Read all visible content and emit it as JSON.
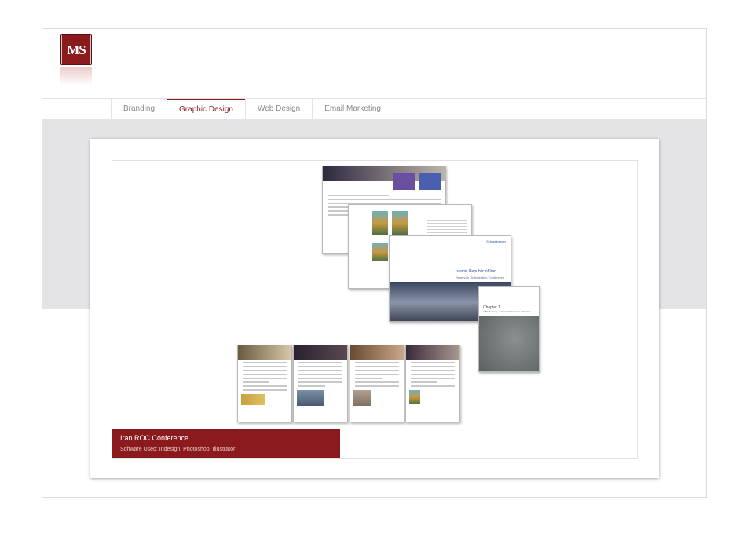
{
  "logo": {
    "letters": "MS"
  },
  "nav": {
    "tabs": [
      {
        "label": "Branding"
      },
      {
        "label": "Graphic Design"
      },
      {
        "label": "Web Design"
      },
      {
        "label": "Email Marketing"
      }
    ],
    "active_index": 1
  },
  "project": {
    "title": "Iran ROC Conference",
    "software": "Software Used: Indesign, Photoshop, Illustrator"
  },
  "brochure": {
    "cover_title": "Islamic Republic of Iran",
    "cover_subtitle": "Reservoir Optimization Conference",
    "chapter_label": "Chapter 1",
    "chapter_subtitle": "A Brief History of Iran's Oil and Gas Industries",
    "brand": "Schlumberger"
  },
  "colors": {
    "accent": "#8b1a1c",
    "band": "#e4e4e6"
  }
}
